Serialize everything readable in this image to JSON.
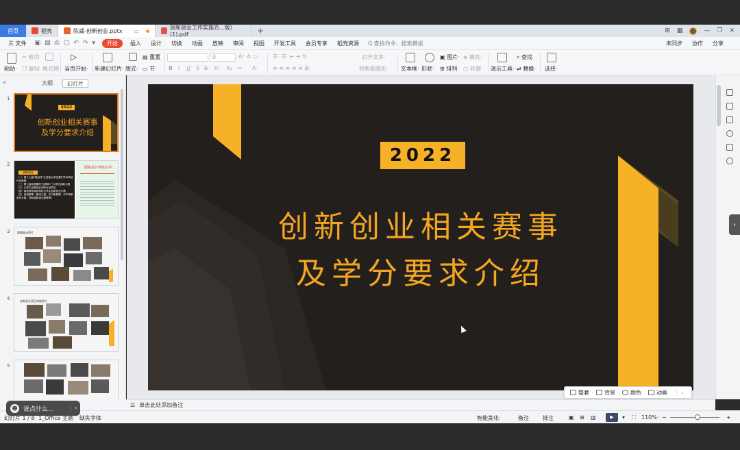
{
  "tabbar": {
    "home": "首页",
    "tabs": [
      {
        "label": "稻壳"
      },
      {
        "label": "陈威-创新创业.pptx"
      },
      {
        "label": "创新创业工作实施方...版）(1).pdf"
      }
    ],
    "add": "+"
  },
  "menubar": {
    "file": "三 文件",
    "start": "开始",
    "items": [
      "插入",
      "设计",
      "切换",
      "动画",
      "放映",
      "审阅",
      "视图",
      "开发工具",
      "会员专享",
      "稻壳资源"
    ],
    "search": "Q 查找命令、搜索模板",
    "right": [
      "未同步",
      "协作",
      "分享"
    ]
  },
  "ribbon": {
    "paste": "粘贴·",
    "cut": "剪切",
    "copy": "复制",
    "format_painter": "格式刷",
    "from_current": "当页开始·",
    "new_slide": "新建幻灯片·",
    "layout": "版式·",
    "reset": "重置",
    "section": "节·",
    "font_size": "0",
    "align_text": "对齐文本·",
    "smart_graphic": "转智能图形·",
    "textbox": "文本框·",
    "shape": "形状·",
    "picture": "图片·",
    "arrange": "排列·",
    "fill": "填充·",
    "outline": "轮廓·",
    "presentation_tools": "演示工具·",
    "find": "查找",
    "replace": "替换·",
    "select": "选择·"
  },
  "leftpanel": {
    "tab_outline": "大纲",
    "tab_slides": "幻灯片",
    "collapse": "«",
    "thumbs": [
      {
        "num": "1",
        "tag": "2022",
        "line1": "创新创业相关赛事",
        "line2": "及学分要求介绍"
      },
      {
        "num": "2",
        "header": "创新创业",
        "doc_title": "服装设计学院文件",
        "lines": [
          "（一）第十七届\"挑战杯\"江西省大学生课外学术科技作品竞赛",
          "（二）第七届中国国际\"互联网+\"大学生创新大赛",
          "（三）大学生创新创业训练计划项目",
          "（四）南昌海华城投标杯大学生创新创业大赛",
          "（五）其他赛事（通讯工程、乐力影像赛、中华商家商业大赛、西柯蓝影视大赛等等）"
        ]
      },
      {
        "num": "3",
        "caption": "赛事展示照片"
      },
      {
        "num": "4",
        "caption": "创新创业项目实践照片"
      },
      {
        "num": "5"
      }
    ]
  },
  "slide": {
    "tag": "2022",
    "title_line1": "创新创业相关赛事",
    "title_line2": "及学分要求介绍"
  },
  "floatbar": {
    "items": [
      "整套",
      "背景",
      "颜色",
      "动画"
    ]
  },
  "notes": {
    "placeholder": "单击此处添加备注"
  },
  "status": {
    "slide_count": "幻灯片 1 / 8",
    "theme": "1_Office 主题",
    "missing_font": "缺失字体",
    "smart_beautify": "智能美化·",
    "notes": "备注·",
    "comments": "批注",
    "zoom": "110%·",
    "zoom_minus": "−",
    "zoom_plus": "+"
  },
  "chat": {
    "placeholder": "说点什么..."
  },
  "colors": {
    "accent_orange": "#f7b126",
    "slide_bg": "#231f1c",
    "title_color": "#f4a623",
    "start_tab": "#e8492f",
    "home_tab": "#3c7be6"
  }
}
